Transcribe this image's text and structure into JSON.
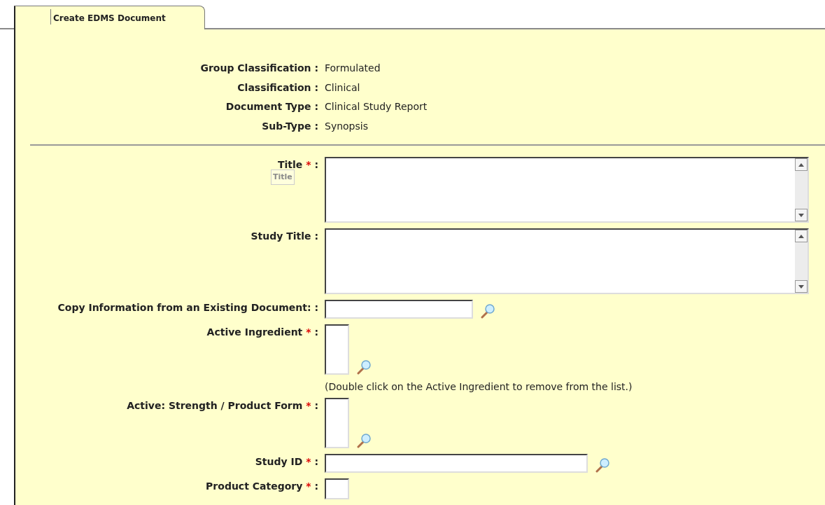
{
  "tabs": [
    {
      "label": "Create EDMS Document",
      "selected": true
    }
  ],
  "summary": [
    {
      "label": "Group Classification",
      "colon": ":",
      "value": "Formulated"
    },
    {
      "label": "Classification",
      "colon": ":",
      "value": "Clinical"
    },
    {
      "label": "Document Type",
      "colon": ":",
      "value": "Clinical Study Report"
    },
    {
      "label": "Sub-Type",
      "colon": ":",
      "value": "Synopsis"
    }
  ],
  "fields": [
    {
      "kind": "textarea",
      "label": "Title",
      "required_mark": "*",
      "colon": ":",
      "tooltip": "Title"
    },
    {
      "kind": "textarea",
      "label": "Study Title",
      "colon": ":"
    },
    {
      "kind": "short",
      "label": "Copy Information from an Existing Document:",
      "colon": ":",
      "lookup": true
    },
    {
      "kind": "list",
      "label": "Active Ingredient",
      "required_mark": "*",
      "colon": ":",
      "lookup": true,
      "note": "(Double click on the Active Ingredient to remove from the list.)"
    },
    {
      "kind": "list",
      "label": "Active: Strength / Product Form",
      "required_mark": "*",
      "colon": ":",
      "lookup": true
    },
    {
      "kind": "medium",
      "label": "Study ID",
      "required_mark": "*",
      "colon": ":",
      "lookup": true
    },
    {
      "kind": "cutlist",
      "label": "Product Category",
      "required_mark": "*",
      "colon": ":"
    }
  ]
}
